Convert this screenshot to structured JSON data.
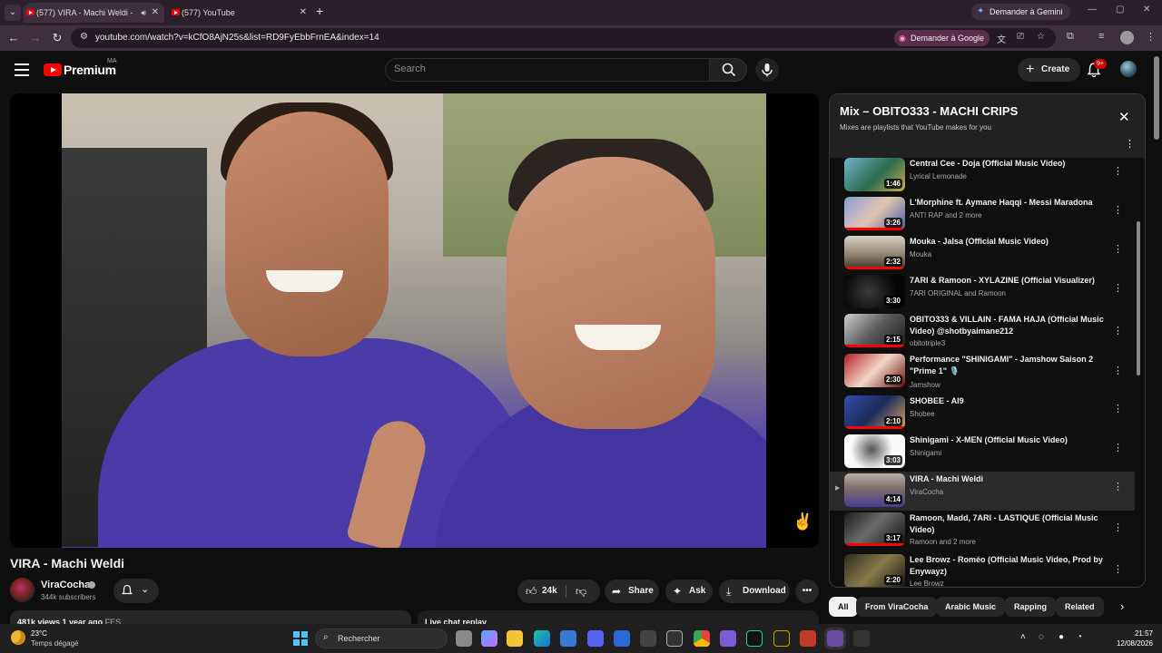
{
  "browser": {
    "tabs": [
      {
        "label": "(577) VIRA - Machi Weldi -"
      },
      {
        "label": "(577) YouTube"
      }
    ],
    "gemini_label": "Demander à Gemini",
    "url": "youtube.com/watch?v=kCfO8AjN25s&list=RD9FyEbbFrnEA&index=14",
    "google_label": "Demander à Google"
  },
  "header": {
    "logo_text": "Premium",
    "country_code": "MA",
    "search_placeholder": "Search",
    "create_label": "Create",
    "notif_badge": "9+"
  },
  "video": {
    "title": "VIRA - Machi Weldi",
    "channel": "ViraCocha",
    "subscribers": "344k subscribers",
    "likes": "24k",
    "share_label": "Share",
    "ask_label": "Ask",
    "download_label": "Download",
    "desc_stats": "481k views  1 year ago",
    "desc_tag": "FES",
    "live_chat_label": "Live chat replay"
  },
  "playlist": {
    "title": "Mix – OBITO333 - MACHI CRIPS",
    "subtitle": "Mixes are playlists that YouTube makes for you",
    "items": [
      {
        "title": "Central Cee - Doja (Official Music Video)",
        "channel": "Lyrical Lemonade",
        "duration": "1:46"
      },
      {
        "title": "L'Morphine ft. Aymane Haqqi - Messi Maradona",
        "channel": "ANTI RAP and 2 more",
        "duration": "3:26"
      },
      {
        "title": "Mouka - Jalsa (Official Music Video)",
        "channel": "Mouka",
        "duration": "2:32"
      },
      {
        "title": "7ARI & Ramoon - XYLAZINE (Official Visualizer)",
        "channel": "7ARI ORIGINAL and Ramoon",
        "duration": "3:30"
      },
      {
        "title": "OBITO333 & VILLAIN - FAMA HAJA (Official Music Video) @shotbyaimane212",
        "channel": "obitotriple3",
        "duration": "2:15"
      },
      {
        "title": "Performance \"SHINIGAMI\" - Jamshow Saison 2 \"Prime 1\" 🎙️",
        "channel": "Jamshow",
        "duration": "2:30"
      },
      {
        "title": "SHOBEE - AI9",
        "channel": "Shobee",
        "duration": "2:10"
      },
      {
        "title": "Shinigami - X-MEN (Official Music Video)",
        "channel": "Shinigami",
        "duration": "3:03"
      },
      {
        "title": "VIRA - Machi Weldi",
        "channel": "ViraCocha",
        "duration": "4:14",
        "current": true
      },
      {
        "title": "Ramoon, Madd, 7ARI - LASTIQUE (Official Music Video)",
        "channel": "Ramoon and 2 more",
        "duration": "3:17"
      },
      {
        "title": "Lee Browz - Roméo (Official Music Video, Prod by Enywayz)",
        "channel": "Lee Browz",
        "duration": "2:20"
      }
    ]
  },
  "chips": [
    "All",
    "From ViraCocha",
    "Arabic Music",
    "Rapping",
    "Related"
  ],
  "taskbar": {
    "temp": "23°C",
    "weather": "Temps dégagé",
    "search_label": "Rechercher",
    "time": "21:57",
    "date": "12/08/2026"
  },
  "colors": {
    "accent": "#ff0000",
    "background": "#0f0f0f",
    "chrome": "#3d2f3e"
  }
}
